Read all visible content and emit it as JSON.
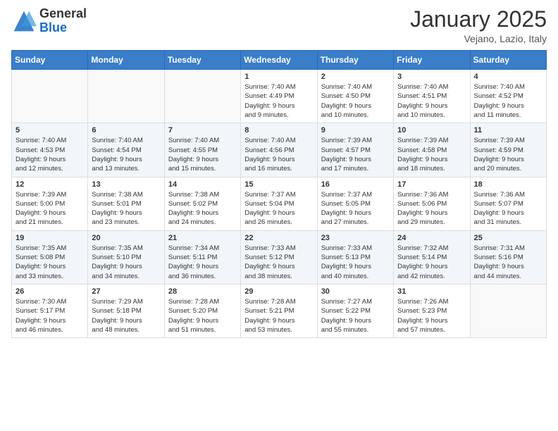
{
  "logo": {
    "general": "General",
    "blue": "Blue"
  },
  "title": "January 2025",
  "location": "Vejano, Lazio, Italy",
  "weekdays": [
    "Sunday",
    "Monday",
    "Tuesday",
    "Wednesday",
    "Thursday",
    "Friday",
    "Saturday"
  ],
  "weeks": [
    [
      {
        "day": "",
        "detail": ""
      },
      {
        "day": "",
        "detail": ""
      },
      {
        "day": "",
        "detail": ""
      },
      {
        "day": "1",
        "detail": "Sunrise: 7:40 AM\nSunset: 4:49 PM\nDaylight: 9 hours\nand 9 minutes."
      },
      {
        "day": "2",
        "detail": "Sunrise: 7:40 AM\nSunset: 4:50 PM\nDaylight: 9 hours\nand 10 minutes."
      },
      {
        "day": "3",
        "detail": "Sunrise: 7:40 AM\nSunset: 4:51 PM\nDaylight: 9 hours\nand 10 minutes."
      },
      {
        "day": "4",
        "detail": "Sunrise: 7:40 AM\nSunset: 4:52 PM\nDaylight: 9 hours\nand 11 minutes."
      }
    ],
    [
      {
        "day": "5",
        "detail": "Sunrise: 7:40 AM\nSunset: 4:53 PM\nDaylight: 9 hours\nand 12 minutes."
      },
      {
        "day": "6",
        "detail": "Sunrise: 7:40 AM\nSunset: 4:54 PM\nDaylight: 9 hours\nand 13 minutes."
      },
      {
        "day": "7",
        "detail": "Sunrise: 7:40 AM\nSunset: 4:55 PM\nDaylight: 9 hours\nand 15 minutes."
      },
      {
        "day": "8",
        "detail": "Sunrise: 7:40 AM\nSunset: 4:56 PM\nDaylight: 9 hours\nand 16 minutes."
      },
      {
        "day": "9",
        "detail": "Sunrise: 7:39 AM\nSunset: 4:57 PM\nDaylight: 9 hours\nand 17 minutes."
      },
      {
        "day": "10",
        "detail": "Sunrise: 7:39 AM\nSunset: 4:58 PM\nDaylight: 9 hours\nand 18 minutes."
      },
      {
        "day": "11",
        "detail": "Sunrise: 7:39 AM\nSunset: 4:59 PM\nDaylight: 9 hours\nand 20 minutes."
      }
    ],
    [
      {
        "day": "12",
        "detail": "Sunrise: 7:39 AM\nSunset: 5:00 PM\nDaylight: 9 hours\nand 21 minutes."
      },
      {
        "day": "13",
        "detail": "Sunrise: 7:38 AM\nSunset: 5:01 PM\nDaylight: 9 hours\nand 23 minutes."
      },
      {
        "day": "14",
        "detail": "Sunrise: 7:38 AM\nSunset: 5:02 PM\nDaylight: 9 hours\nand 24 minutes."
      },
      {
        "day": "15",
        "detail": "Sunrise: 7:37 AM\nSunset: 5:04 PM\nDaylight: 9 hours\nand 26 minutes."
      },
      {
        "day": "16",
        "detail": "Sunrise: 7:37 AM\nSunset: 5:05 PM\nDaylight: 9 hours\nand 27 minutes."
      },
      {
        "day": "17",
        "detail": "Sunrise: 7:36 AM\nSunset: 5:06 PM\nDaylight: 9 hours\nand 29 minutes."
      },
      {
        "day": "18",
        "detail": "Sunrise: 7:36 AM\nSunset: 5:07 PM\nDaylight: 9 hours\nand 31 minutes."
      }
    ],
    [
      {
        "day": "19",
        "detail": "Sunrise: 7:35 AM\nSunset: 5:08 PM\nDaylight: 9 hours\nand 33 minutes."
      },
      {
        "day": "20",
        "detail": "Sunrise: 7:35 AM\nSunset: 5:10 PM\nDaylight: 9 hours\nand 34 minutes."
      },
      {
        "day": "21",
        "detail": "Sunrise: 7:34 AM\nSunset: 5:11 PM\nDaylight: 9 hours\nand 36 minutes."
      },
      {
        "day": "22",
        "detail": "Sunrise: 7:33 AM\nSunset: 5:12 PM\nDaylight: 9 hours\nand 38 minutes."
      },
      {
        "day": "23",
        "detail": "Sunrise: 7:33 AM\nSunset: 5:13 PM\nDaylight: 9 hours\nand 40 minutes."
      },
      {
        "day": "24",
        "detail": "Sunrise: 7:32 AM\nSunset: 5:14 PM\nDaylight: 9 hours\nand 42 minutes."
      },
      {
        "day": "25",
        "detail": "Sunrise: 7:31 AM\nSunset: 5:16 PM\nDaylight: 9 hours\nand 44 minutes."
      }
    ],
    [
      {
        "day": "26",
        "detail": "Sunrise: 7:30 AM\nSunset: 5:17 PM\nDaylight: 9 hours\nand 46 minutes."
      },
      {
        "day": "27",
        "detail": "Sunrise: 7:29 AM\nSunset: 5:18 PM\nDaylight: 9 hours\nand 48 minutes."
      },
      {
        "day": "28",
        "detail": "Sunrise: 7:28 AM\nSunset: 5:20 PM\nDaylight: 9 hours\nand 51 minutes."
      },
      {
        "day": "29",
        "detail": "Sunrise: 7:28 AM\nSunset: 5:21 PM\nDaylight: 9 hours\nand 53 minutes."
      },
      {
        "day": "30",
        "detail": "Sunrise: 7:27 AM\nSunset: 5:22 PM\nDaylight: 9 hours\nand 55 minutes."
      },
      {
        "day": "31",
        "detail": "Sunrise: 7:26 AM\nSunset: 5:23 PM\nDaylight: 9 hours\nand 57 minutes."
      },
      {
        "day": "",
        "detail": ""
      }
    ]
  ]
}
